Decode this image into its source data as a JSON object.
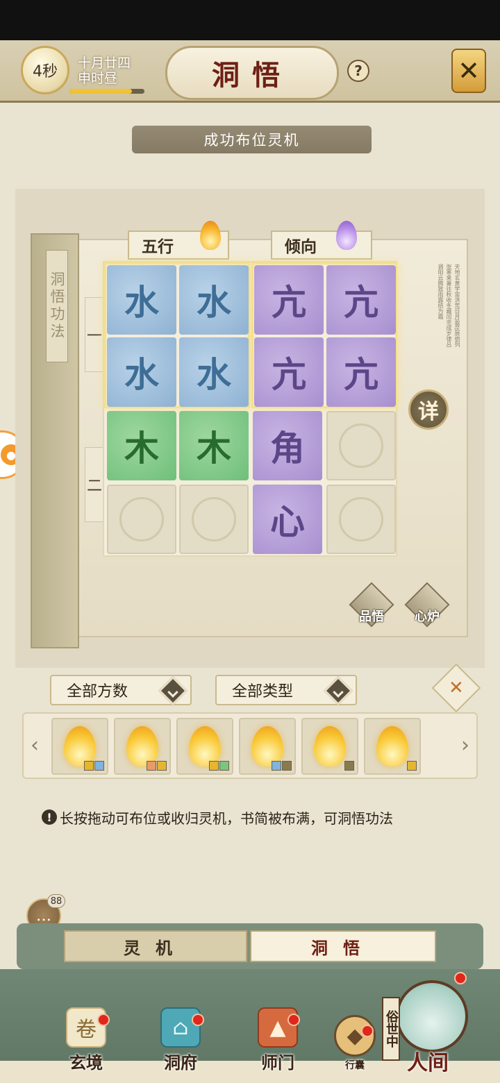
{
  "header": {
    "timer": "4秒",
    "date_line1": "十月廿四",
    "date_line2": "申时昼",
    "time_progress": 0.83,
    "title": "洞悟",
    "help_icon": "question-icon",
    "close_icon": "close-icon"
  },
  "banner": {
    "text": "成功布位灵机"
  },
  "book": {
    "spine_label": "洞悟功法",
    "row_labels": [
      "一",
      "二"
    ],
    "columns": [
      {
        "label": "五行",
        "icon": "flame-orange-icon"
      },
      {
        "label": "倾向",
        "icon": "flame-purple-icon"
      }
    ],
    "grid": [
      [
        "水",
        "水",
        "亢",
        "亢"
      ],
      [
        "水",
        "水",
        "亢",
        "亢"
      ],
      [
        "木",
        "木",
        "角",
        ""
      ],
      [
        "",
        "",
        "心",
        ""
      ]
    ],
    "detail_label": "详",
    "actions": [
      {
        "label": "品悟",
        "icon": "scroll-icon"
      },
      {
        "label": "心炉",
        "icon": "flame-icon"
      }
    ]
  },
  "filters": {
    "count_label": "全部方数",
    "type_label": "全部类型",
    "sort_icon": "crossed-icon"
  },
  "items": [
    {
      "icon": "flame-icon",
      "swatches": [
        "#e6b62f",
        "#7fb3e0"
      ]
    },
    {
      "icon": "flame-icon",
      "swatches": [
        "#e99a6a",
        "#e6b62f"
      ]
    },
    {
      "icon": "flame-icon",
      "swatches": [
        "#e6b62f",
        "#7cc47f"
      ]
    },
    {
      "icon": "flame-icon",
      "swatches": [
        "#7fb3e0",
        "#8a7b4f"
      ]
    },
    {
      "icon": "flame-icon",
      "swatches": [
        "#8a7b4f"
      ]
    },
    {
      "icon": "flame-icon",
      "swatches": [
        "#e6b62f"
      ]
    }
  ],
  "hint": {
    "icon": "!",
    "text": "长按拖动可布位或收归灵机，书简被布满，可洞悟功法"
  },
  "chat": {
    "badge": "88",
    "icon": "chat-icon"
  },
  "tabs": [
    {
      "label": "灵机",
      "active": false
    },
    {
      "label": "洞悟",
      "active": true
    }
  ],
  "nav": [
    {
      "label": "玄境",
      "icon": "scroll-icon"
    },
    {
      "label": "洞府",
      "icon": "pavilion-icon"
    },
    {
      "label": "师门",
      "icon": "banner-icon"
    },
    {
      "label": "行囊",
      "icon": "pouch-icon"
    }
  ],
  "world": {
    "sign": "俗世中",
    "label": "人间"
  }
}
